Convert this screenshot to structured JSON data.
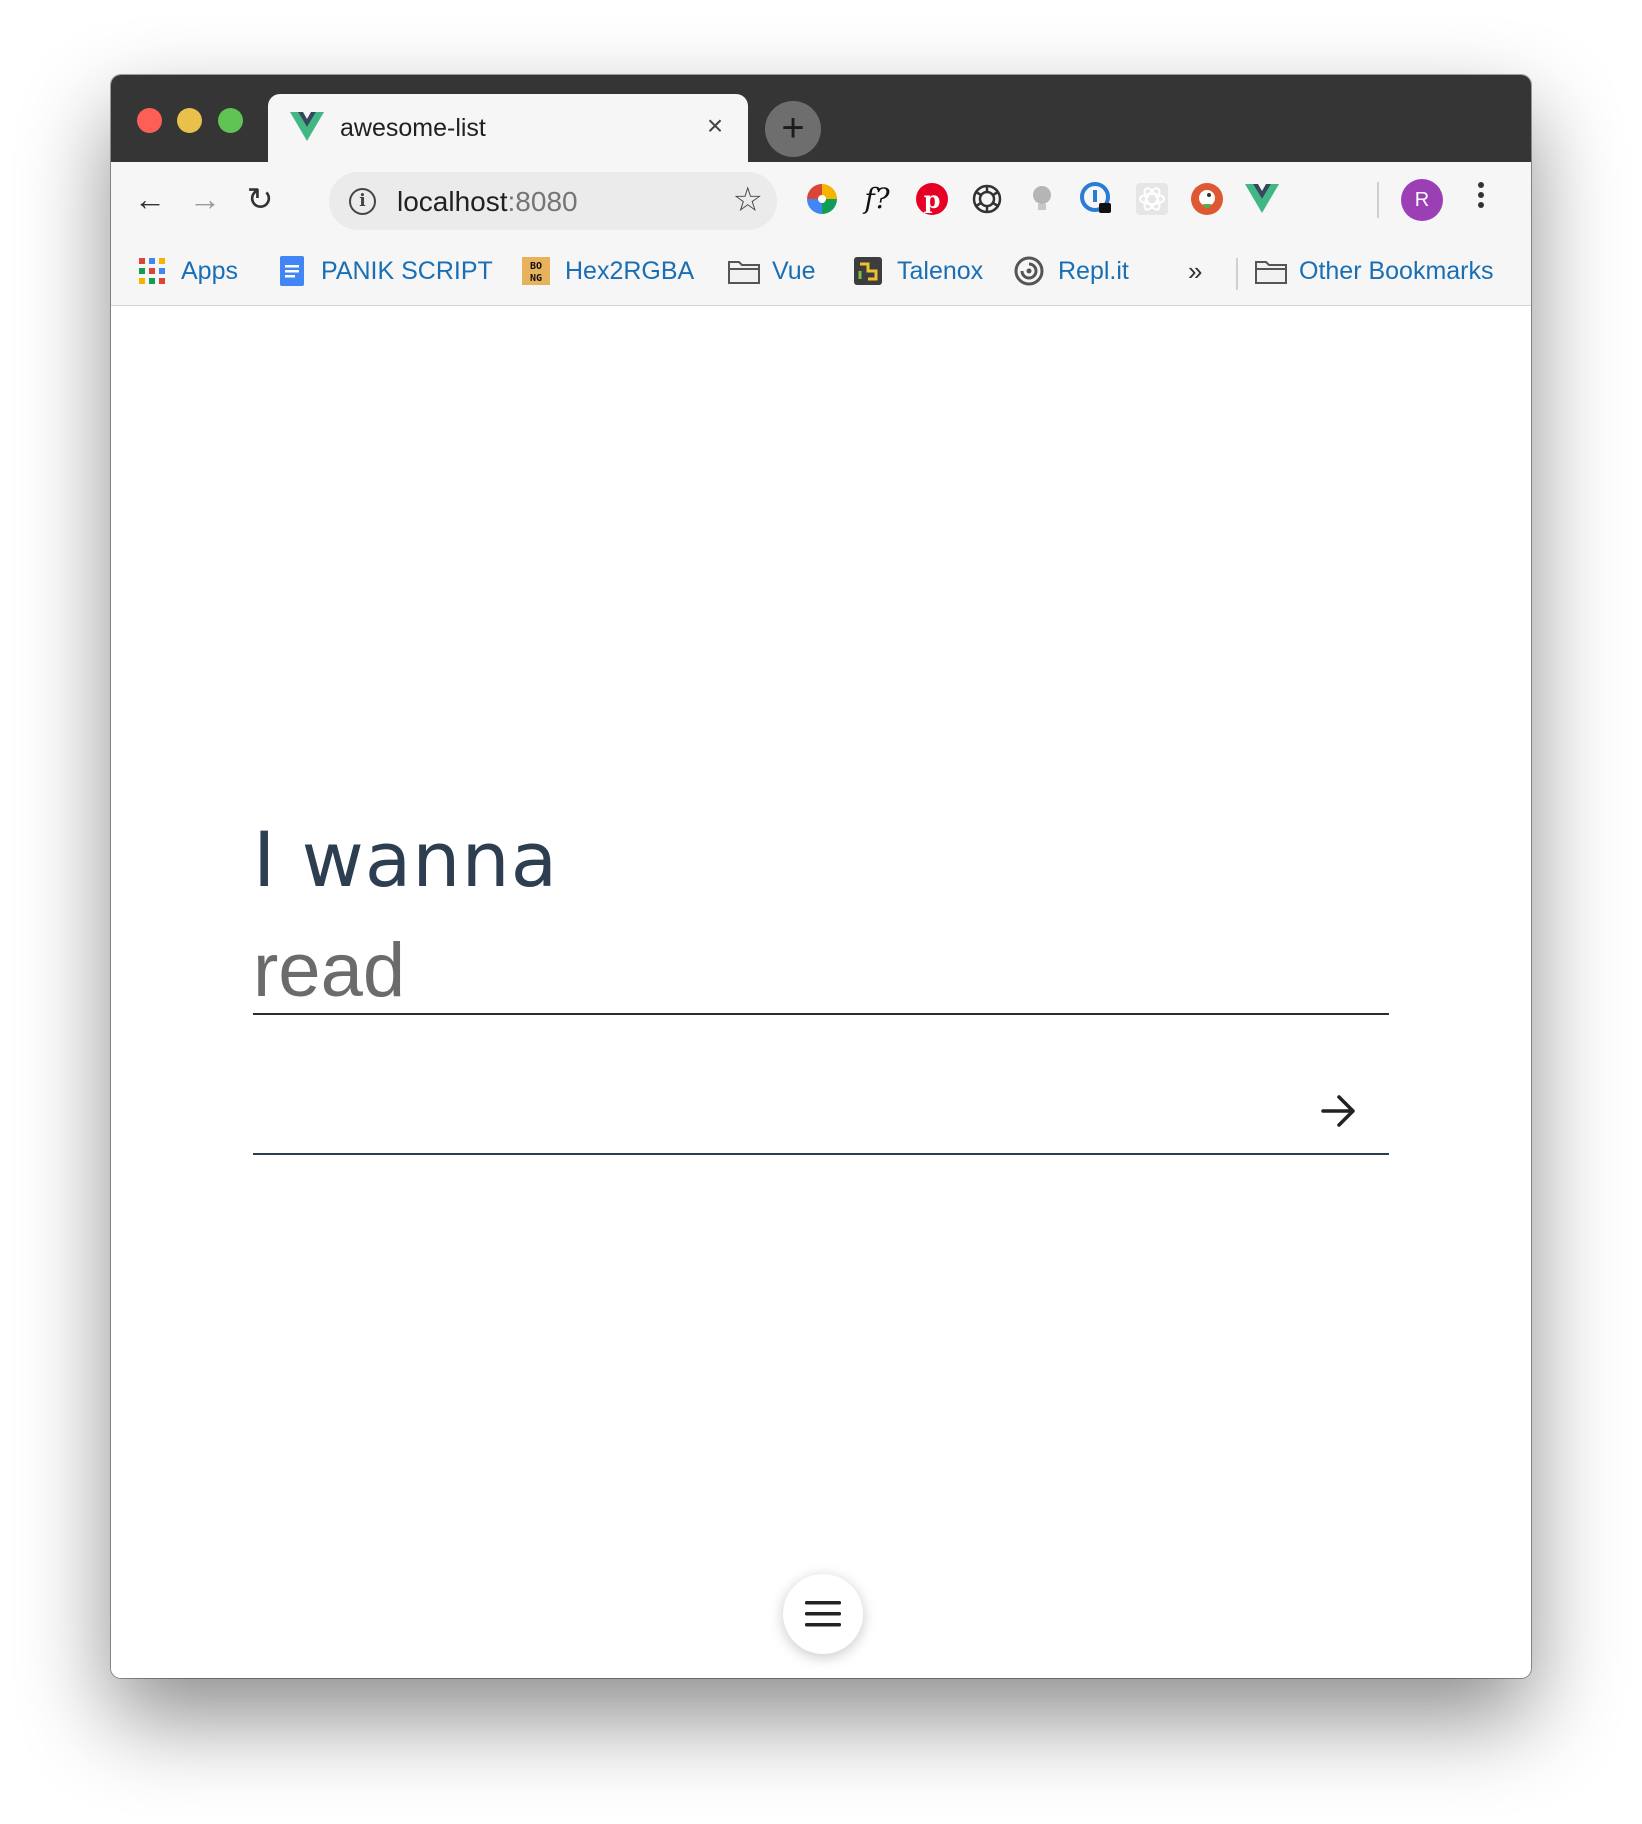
{
  "browser": {
    "tab": {
      "title": "awesome-list",
      "close_glyph": "×",
      "favicon": "vue-logo-icon"
    },
    "new_tab_glyph": "+",
    "address": {
      "host": "localhost",
      "port": ":8080"
    },
    "nav": {
      "back_glyph": "←",
      "forward_glyph": "→",
      "reload_glyph": "↻",
      "star_glyph": "☆"
    },
    "extensions": [
      "color-wheel-icon",
      "whatfont-icon",
      "pinterest-icon",
      "openai-icon",
      "lightbulb-icon",
      "password-manager-icon",
      "react-devtools-icon",
      "duckduckgo-icon",
      "vue-devtools-icon"
    ],
    "whatfont_label": "f?",
    "avatar_initial": "R",
    "bookmarks": [
      {
        "label": "Apps",
        "icon": "apps-grid-icon"
      },
      {
        "label": "PANIK SCRIPT",
        "icon": "google-docs-icon"
      },
      {
        "label": "Hex2RGBA",
        "icon": "bong-icon"
      },
      {
        "label": "Vue",
        "icon": "folder-icon"
      },
      {
        "label": "Talenox",
        "icon": "talenox-icon"
      },
      {
        "label": "Repl.it",
        "icon": "replit-icon"
      }
    ],
    "bookmarks_overflow_glyph": "»",
    "other_bookmarks": "Other Bookmarks",
    "bong_text": "BO NG"
  },
  "page": {
    "prompt": "I wanna",
    "verb_select_value": "read",
    "item_input_value": "",
    "colors": {
      "text": "#2c3e50",
      "select_text": "#6b6b6b"
    }
  }
}
